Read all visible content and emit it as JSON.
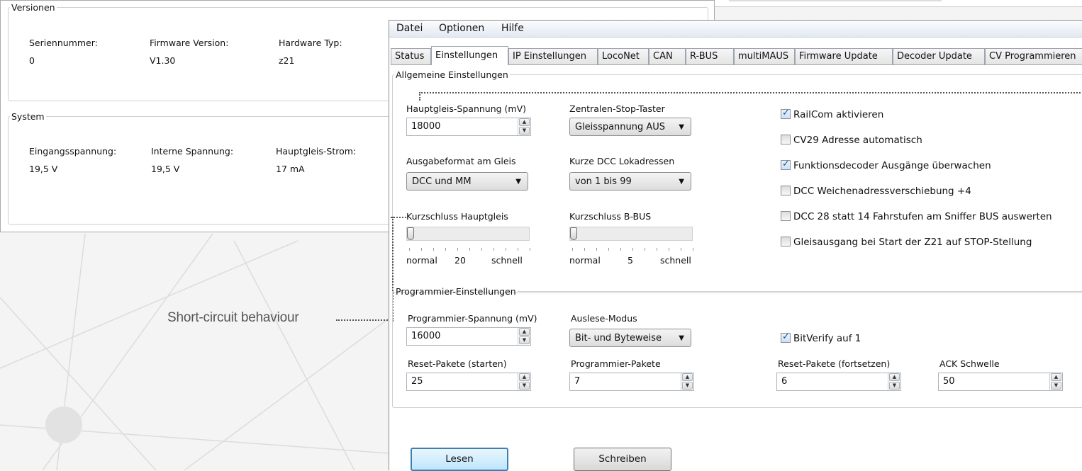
{
  "back_window": {
    "versions_group": {
      "title": "Versionen",
      "fields": [
        {
          "label": "Seriennummer:",
          "value": "0"
        },
        {
          "label": "Firmware Version:",
          "value": "V1.30"
        },
        {
          "label": "Hardware Typ:",
          "value": "z21"
        }
      ]
    },
    "system_group": {
      "title": "System",
      "fields": [
        {
          "label": "Eingangsspannung:",
          "value": "19,5 V"
        },
        {
          "label": "Interne Spannung:",
          "value": "19,5 V"
        },
        {
          "label": "Hauptgleis-Strom:",
          "value": "17 mA"
        }
      ]
    }
  },
  "front_window": {
    "menu": [
      "Datei",
      "Optionen",
      "Hilfe"
    ],
    "tabs": [
      "Status",
      "Einstellungen",
      "IP Einstellungen",
      "LocoNet",
      "CAN",
      "R-BUS",
      "multiMAUS",
      "Firmware Update",
      "Decoder Update",
      "CV Programmieren"
    ],
    "active_tab": "Einstellungen",
    "general": {
      "title": "Allgemeine Einstellungen",
      "main_track_voltage": {
        "label": "Hauptgleis-Spannung (mV)",
        "value": "18000"
      },
      "stop_button": {
        "label": "Zentralen-Stop-Taster",
        "value": "Gleisspannung AUS"
      },
      "output_format": {
        "label": "Ausgabeformat am Gleis",
        "value": "DCC und MM"
      },
      "short_dcc": {
        "label": "Kurze DCC Lokadressen",
        "value": "von 1 bis 99"
      },
      "short_main": {
        "label": "Kurzschluss Hauptgleis",
        "min_label": "normal",
        "mid_label": "20",
        "max_label": "schnell",
        "position": 0
      },
      "short_bbus": {
        "label": "Kurzschluss B-BUS",
        "min_label": "normal",
        "mid_label": "5",
        "max_label": "schnell",
        "position": 0
      },
      "checkboxes": [
        {
          "label": "RailCom aktivieren",
          "checked": true
        },
        {
          "label": "CV29 Adresse automatisch",
          "checked": false
        },
        {
          "label": "Funktionsdecoder Ausgänge überwachen",
          "checked": true
        },
        {
          "label": "DCC Weichenadressverschiebung +4",
          "checked": false
        },
        {
          "label": "DCC 28 statt 14 Fahrstufen am Sniffer BUS auswerten",
          "checked": false
        },
        {
          "label": "Gleisausgang bei Start der Z21 auf STOP-Stellung",
          "checked": false
        }
      ]
    },
    "programming": {
      "title": "Programmier-Einstellungen",
      "prog_voltage": {
        "label": "Programmier-Spannung (mV)",
        "value": "16000"
      },
      "read_mode": {
        "label": "Auslese-Modus",
        "value": "Bit- und Byteweise"
      },
      "bitverify": {
        "label": "BitVerify auf 1",
        "checked": true
      },
      "reset_start": {
        "label": "Reset-Pakete (starten)",
        "value": "25"
      },
      "prog_packets": {
        "label": "Programmier-Pakete",
        "value": "7"
      },
      "reset_continue": {
        "label": "Reset-Pakete (fortsetzen)",
        "value": "6"
      },
      "ack_threshold": {
        "label": "ACK Schwelle",
        "value": "50"
      }
    },
    "buttons": {
      "read": "Lesen",
      "write": "Schreiben"
    }
  },
  "callout": "Short-circuit behaviour"
}
